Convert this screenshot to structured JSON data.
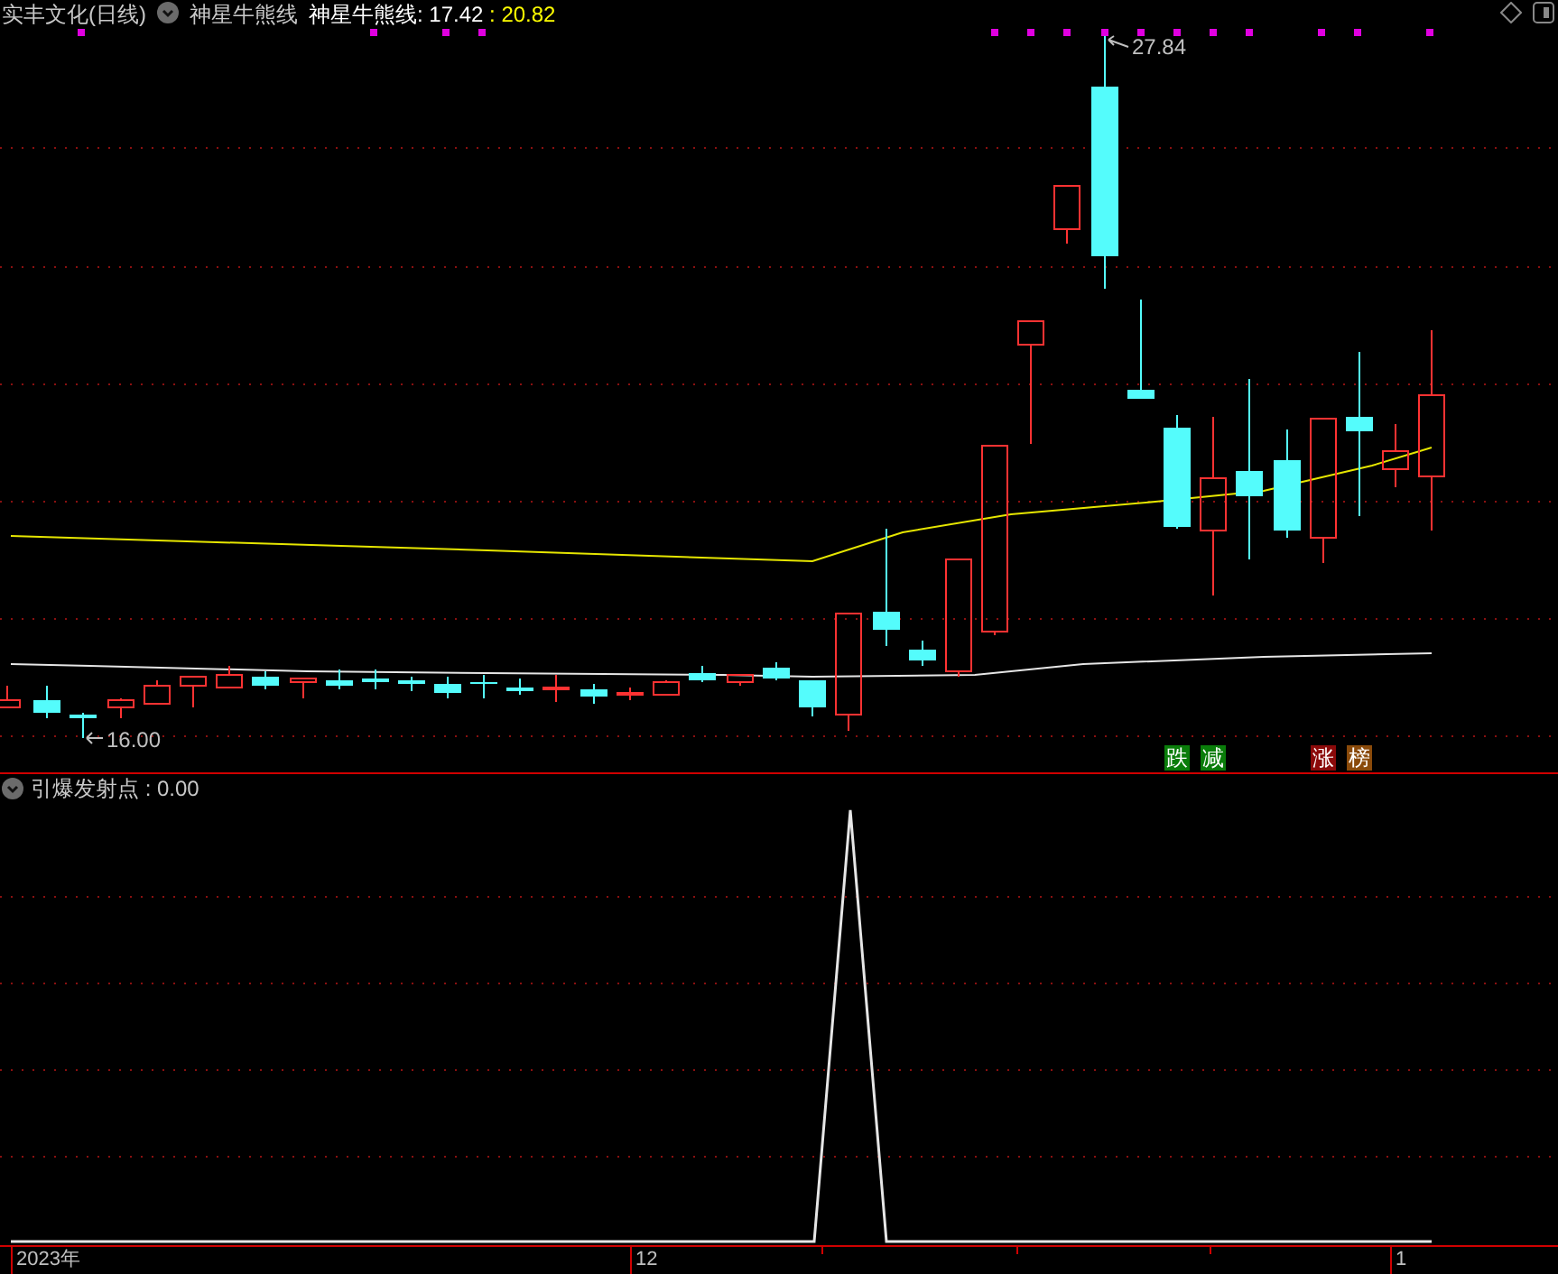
{
  "header": {
    "title": "实丰文化(日线)",
    "indicator_name": "神星牛熊线",
    "readout_label": "神星牛熊线: 17.42",
    "readout_value": " : 20.82"
  },
  "main_chart": {
    "high_label": "27.84",
    "low_label": "16.00",
    "badges": [
      {
        "text": "跌",
        "color": "#0a7d0a"
      },
      {
        "text": "减",
        "color": "#0a7d0a"
      },
      {
        "text": "涨",
        "color": "#8b0a0a"
      },
      {
        "text": "榜",
        "color": "#8a4a0a"
      }
    ]
  },
  "sub_panel": {
    "title": "引爆发射点 : 0.00"
  },
  "x_axis": {
    "labels": [
      "2023年",
      "12",
      "1"
    ]
  }
}
